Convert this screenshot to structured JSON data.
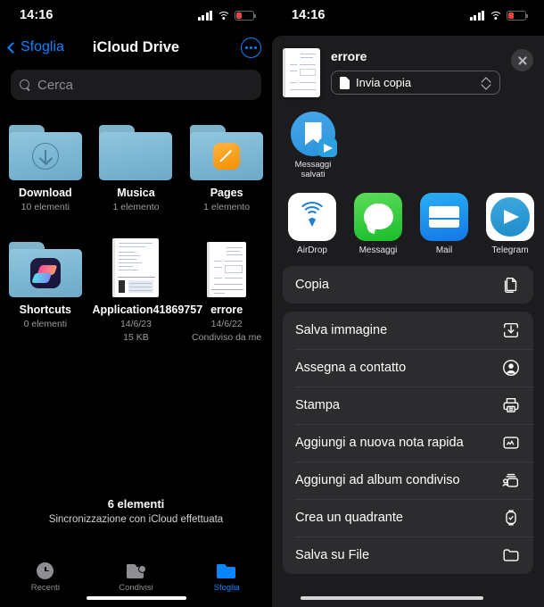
{
  "status_bar": {
    "time": "14:16",
    "signal_icon": "cellular-bars-icon",
    "wifi_icon": "wifi-icon",
    "battery_icon": "battery-low-icon",
    "battery_color": "#e8463c"
  },
  "files_app": {
    "nav": {
      "back_label": "Sfoglia",
      "title": "iCloud Drive",
      "more_icon": "ellipsis-circle-icon",
      "accent": "#0a84ff"
    },
    "search": {
      "placeholder": "Cerca",
      "icon": "search-icon"
    },
    "items": [
      {
        "name": "Download",
        "meta": "10 elementi",
        "meta2": "",
        "kind": "folder",
        "glyph": "download-arrow-icon"
      },
      {
        "name": "Musica",
        "meta": "1 elemento",
        "meta2": "",
        "kind": "folder",
        "glyph": ""
      },
      {
        "name": "Pages",
        "meta": "1 elemento",
        "meta2": "",
        "kind": "folder",
        "glyph": "pages-app-icon"
      },
      {
        "name": "Shortcuts",
        "meta": "0 elementi",
        "meta2": "",
        "kind": "folder",
        "glyph": "shortcuts-app-icon"
      },
      {
        "name": "Application41869757",
        "meta": "14/6/23",
        "meta2": "15 KB",
        "kind": "document",
        "glyph": "document-page-icon"
      },
      {
        "name": "errore",
        "meta": "14/6/22",
        "meta2": "Condiviso da me",
        "kind": "document",
        "glyph": "document-page-icon"
      }
    ],
    "footer": {
      "count": "6 elementi",
      "sync": "Sincronizzazione con iCloud effettuata"
    },
    "tabs": [
      {
        "label": "Recenti",
        "icon": "clock-icon",
        "active": false
      },
      {
        "label": "Condivisi",
        "icon": "shared-folder-icon",
        "active": false
      },
      {
        "label": "Sfoglia",
        "icon": "folder-icon",
        "active": true
      }
    ]
  },
  "share_sheet": {
    "header": {
      "title": "errore",
      "preview_icon": "document-preview-icon",
      "option_label": "Invia copia",
      "option_icon": "document-icon",
      "option_chevron_icon": "up-down-chevron-icon",
      "close_icon": "close-icon"
    },
    "suggestions": [
      {
        "label": "Messaggi salvati",
        "icon": "saved-messages-bookmark-icon",
        "badge_icon": "telegram-badge-icon"
      }
    ],
    "apps": [
      {
        "label": "AirDrop",
        "icon": "airdrop-icon"
      },
      {
        "label": "Messaggi",
        "icon": "messages-icon"
      },
      {
        "label": "Mail",
        "icon": "mail-icon"
      },
      {
        "label": "Telegram",
        "icon": "telegram-icon"
      },
      {
        "label": "",
        "icon": "partial-app-icon"
      }
    ],
    "actions_primary": [
      {
        "label": "Copia",
        "icon": "copy-icon"
      }
    ],
    "actions_list": [
      {
        "label": "Salva immagine",
        "icon": "save-image-icon"
      },
      {
        "label": "Assegna a contatto",
        "icon": "contact-icon"
      },
      {
        "label": "Stampa",
        "icon": "printer-icon"
      },
      {
        "label": "Aggiungi a nuova nota rapida",
        "icon": "quick-note-icon"
      },
      {
        "label": "Aggiungi ad album condiviso",
        "icon": "shared-album-icon"
      },
      {
        "label": "Crea un quadrante",
        "icon": "watch-face-icon"
      },
      {
        "label": "Salva su File",
        "icon": "folder-icon"
      }
    ]
  }
}
